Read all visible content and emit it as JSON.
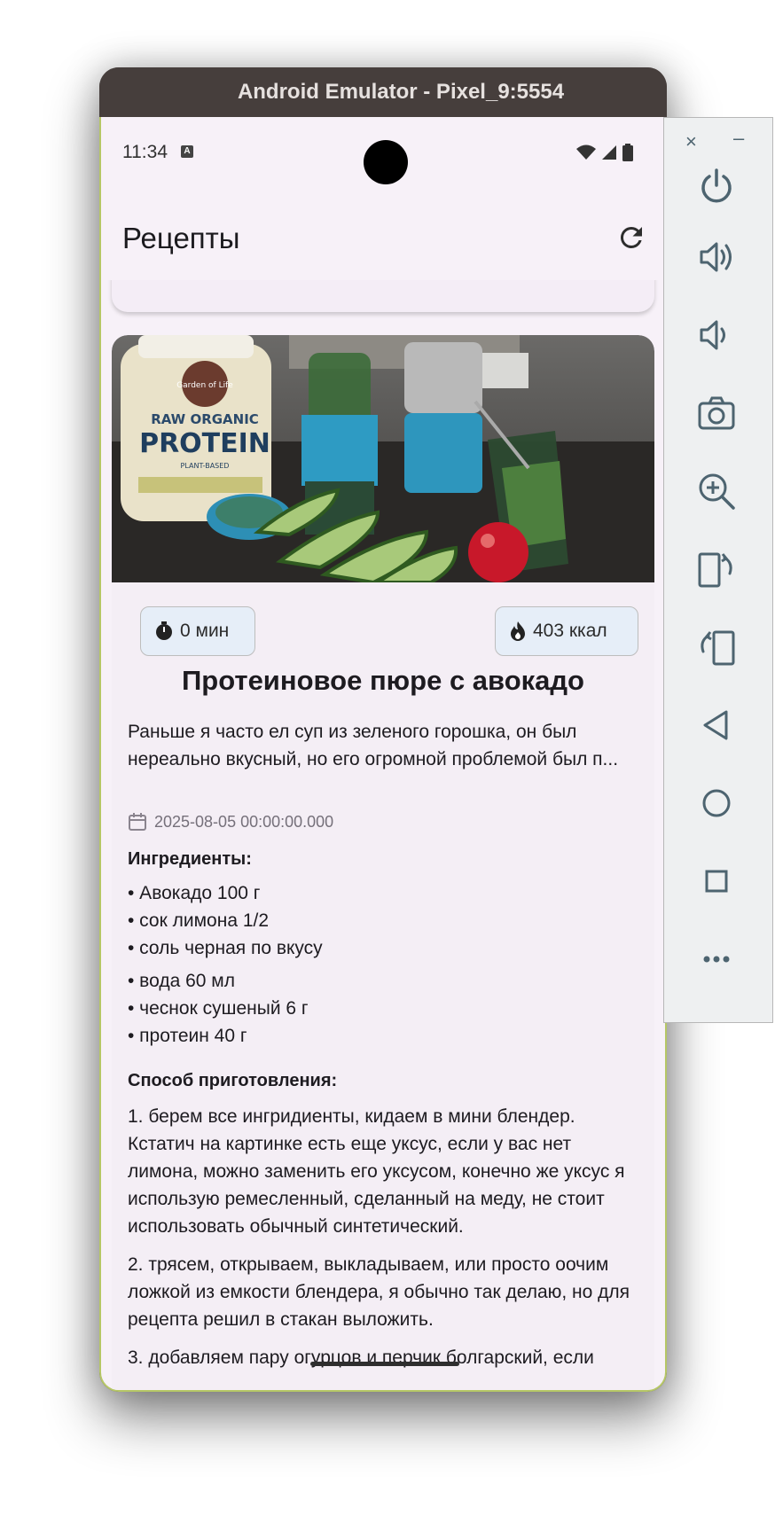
{
  "window": {
    "title": "Android Emulator - Pixel_9:5554"
  },
  "status_bar": {
    "time": "11:34",
    "notification_badge": "A"
  },
  "app_bar": {
    "title": "Рецепты",
    "refresh_icon": "refresh-icon"
  },
  "recipe": {
    "time_label": "0 мин",
    "calories_label": "403 ккал",
    "title": "Протеиновое пюре с авокадо",
    "description": "Раньше я часто ел суп из зеленого горошка, он был нереально вкусный, но его огромной проблемой был п...",
    "date": "2025-08-05 00:00:00.000",
    "ingredients_heading": "Ингредиенты:",
    "ingredients": [
      "• Авокадо 100 г",
      "• сок лимона 1/2",
      "• соль черная по вкусу",
      "• вода 60 мл",
      "• чеснок сушеный 6 г",
      "• протеин 40 г"
    ],
    "method_heading": "Способ приготовления:",
    "steps": [
      "1. берем все ингридиенты, кидаем в мини блендер. Кстатич на картинке есть еще уксус, если у вас нет лимона, можно заменить его уксусом, конечно же уксус я использую ремесленный, сделанный на меду, не стоит использовать обычный синтетический.",
      "2. трясем, открываем, выкладываем, или просто оочим ложкой из емкости блендера, я обычно так делаю, но для рецепта решил в стакан выложить.",
      "3. добавляем пару огурцов и перчик болгарский, если"
    ],
    "photo_label_brand": "Garden of Life",
    "photo_label_line1": "RAW ORGANIC",
    "photo_label_line2": "PROTEIN",
    "photo_label_line3": "PLANT-BASED"
  },
  "emulator_panel": {
    "close": "×",
    "minimize": "–",
    "buttons": [
      "power-icon",
      "volume-up-icon",
      "volume-down-icon",
      "camera-icon",
      "zoom-icon",
      "rotate-left-icon",
      "rotate-right-icon",
      "back-icon",
      "home-icon",
      "overview-icon",
      "more-icon"
    ]
  },
  "colors": {
    "titlebar": "#463e3c",
    "phone_bg": "#f7f1f8",
    "chip_bg": "#e6eef8",
    "panel_icon": "#4d6470"
  }
}
